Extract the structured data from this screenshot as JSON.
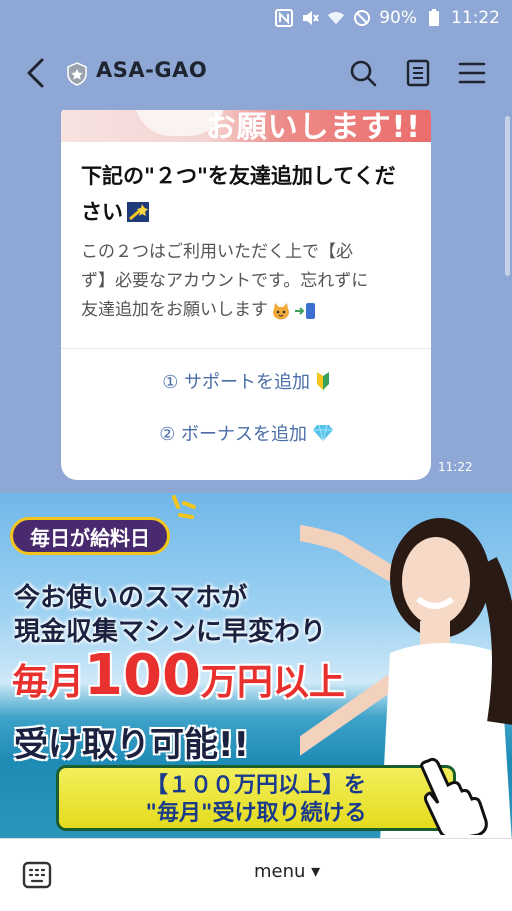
{
  "status": {
    "battery": "90%",
    "time": "11:22",
    "icons": [
      "nfc-icon",
      "mute-icon",
      "wifi-icon",
      "block-icon"
    ]
  },
  "header": {
    "title": "ASA-GAO",
    "icons": [
      "back-icon",
      "shield-icon",
      "search-icon",
      "notes-icon",
      "menu-icon"
    ]
  },
  "card": {
    "banner_text": "お願いします!!",
    "title_line1": "下記の\"２つ\"を友達追加してくだ",
    "title_line2": "さい",
    "body_line1": "この２つはご利用いただく上で【必",
    "body_line2": "ず】必要なアカウントです。忘れずに",
    "body_line3": "友達追加をお願いします",
    "action1": "① サポートを追加",
    "action2": "② ボーナスを追加",
    "time": "11:22"
  },
  "banner": {
    "pill": "毎日が給料日",
    "line1": "今お使いのスマホが",
    "line2": "現金収集マシンに早変わり",
    "big_a": "毎月",
    "big_num": "100",
    "big_b": "万円以上",
    "line3": "受け取り可能!!",
    "cta_line1": "【１００万円以上】を",
    "cta_line2": "\"毎月\"受け取り続ける"
  },
  "bottom": {
    "menu_label": "menu ▾",
    "keyboard_icon": "keyboard-icon"
  }
}
